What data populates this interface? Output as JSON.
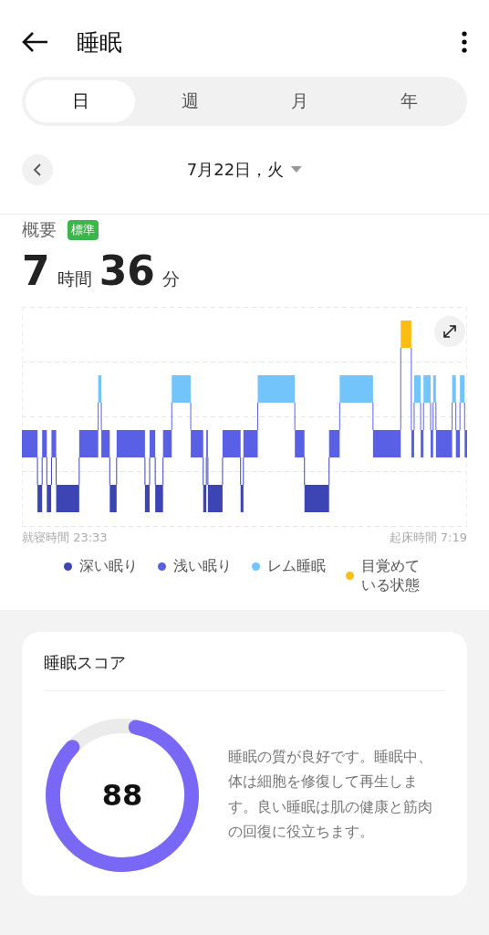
{
  "header": {
    "title": "睡眠"
  },
  "tabs": [
    {
      "label": "日",
      "selected": true
    },
    {
      "label": "週",
      "selected": false
    },
    {
      "label": "月",
      "selected": false
    },
    {
      "label": "年",
      "selected": false
    }
  ],
  "date": {
    "label": "7月22日，火"
  },
  "summary": {
    "title": "概要",
    "badge": "標準",
    "hours": "7",
    "hours_unit": "時間",
    "minutes": "36",
    "minutes_unit": "分"
  },
  "chart": {
    "kind": "picture",
    "start": "就寝時間 23:33",
    "end": "起床時間 7:19"
  },
  "legend": [
    {
      "label": "深い眠り",
      "color": "#3d44b4"
    },
    {
      "label": "浅い眠り",
      "color": "#5a60e6"
    },
    {
      "label": "レム睡眠",
      "color": "#72c4fa"
    },
    {
      "label": "目覚めている状態",
      "color": "#fbbd14"
    }
  ],
  "score": {
    "title": "睡眠スコア",
    "value": "88",
    "level": 0.88,
    "text": "睡眠の質が良好です。睡眠中、体は細胞を修復して再生します。良い睡眠は肌の健康と筋肉の回復に役立ちます。"
  }
}
